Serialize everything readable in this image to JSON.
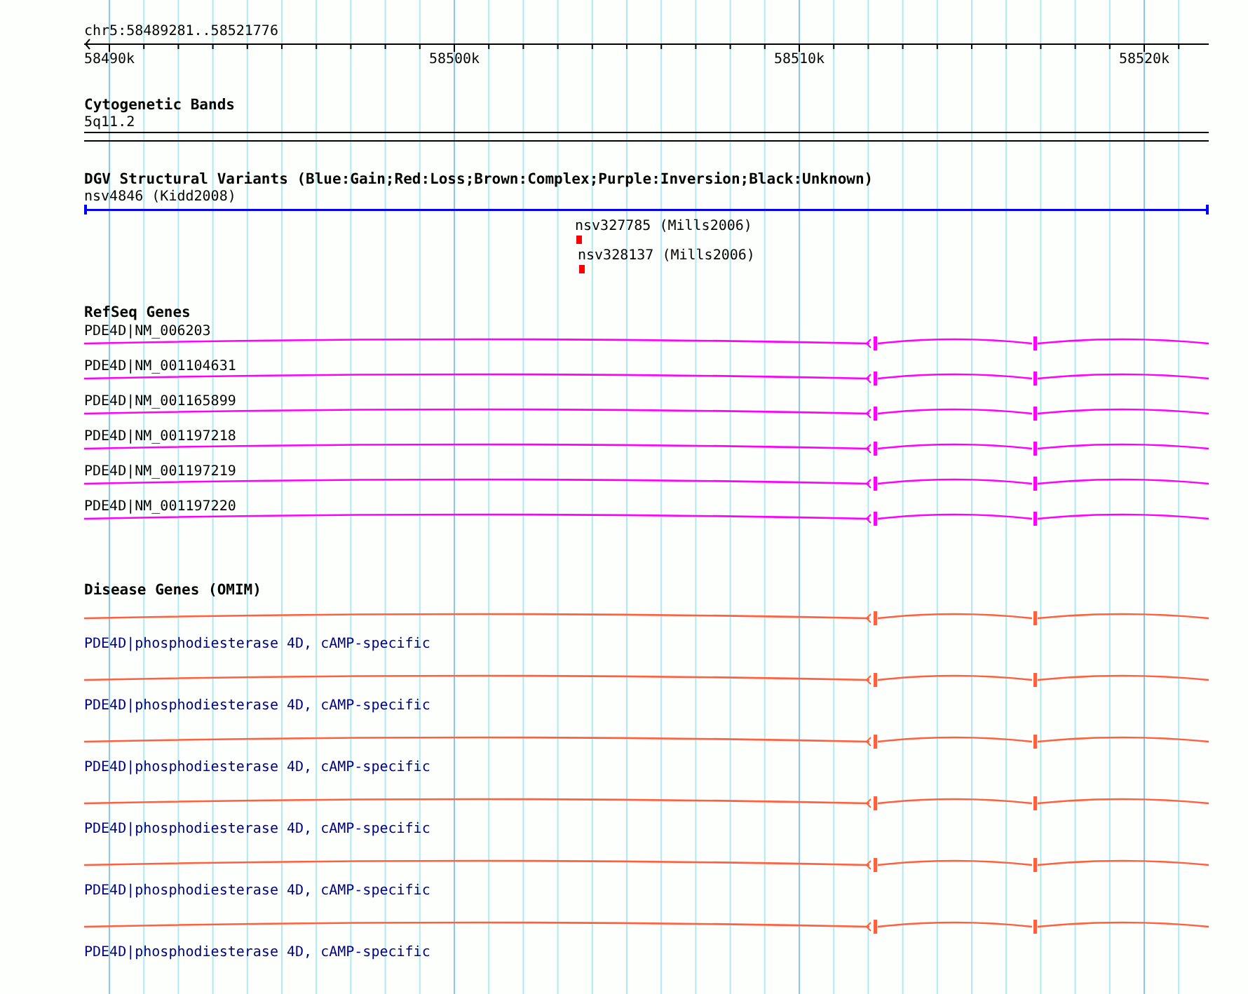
{
  "ruler": {
    "region": "chr5:58489281..58521776",
    "ticks": [
      "58490k",
      "58500k",
      "58510k",
      "58520k"
    ]
  },
  "tracks": [
    {
      "kind": "cytoband",
      "title": "Cytogenetic Bands",
      "features": [
        {
          "label": "5q11.2"
        }
      ]
    },
    {
      "kind": "variants",
      "title": "DGV Structural Variants (Blue:Gain;Red:Loss;Brown:Complex;Purple:Inversion;Black:Unknown)",
      "features": [
        {
          "label": "nsv4846 (Kidd2008)",
          "color": "#0000ff"
        },
        {
          "label": "nsv327785 (Mills2006)",
          "color": "#ff0000"
        },
        {
          "label": "nsv328137 (Mills2006)",
          "color": "#ff0000"
        }
      ]
    },
    {
      "kind": "refseq",
      "title": "RefSeq Genes",
      "features": [
        {
          "label": "PDE4D|NM_006203"
        },
        {
          "label": "PDE4D|NM_001104631"
        },
        {
          "label": "PDE4D|NM_001165899"
        },
        {
          "label": "PDE4D|NM_001197218"
        },
        {
          "label": "PDE4D|NM_001197219"
        },
        {
          "label": "PDE4D|NM_001197220"
        }
      ]
    },
    {
      "kind": "omim",
      "title": "Disease Genes (OMIM)",
      "features": [
        {
          "label": "PDE4D|phosphodiesterase 4D, cAMP-specific"
        },
        {
          "label": "PDE4D|phosphodiesterase 4D, cAMP-specific"
        },
        {
          "label": "PDE4D|phosphodiesterase 4D, cAMP-specific"
        },
        {
          "label": "PDE4D|phosphodiesterase 4D, cAMP-specific"
        },
        {
          "label": "PDE4D|phosphodiesterase 4D, cAMP-specific"
        },
        {
          "label": "PDE4D|phosphodiesterase 4D, cAMP-specific"
        }
      ]
    }
  ]
}
